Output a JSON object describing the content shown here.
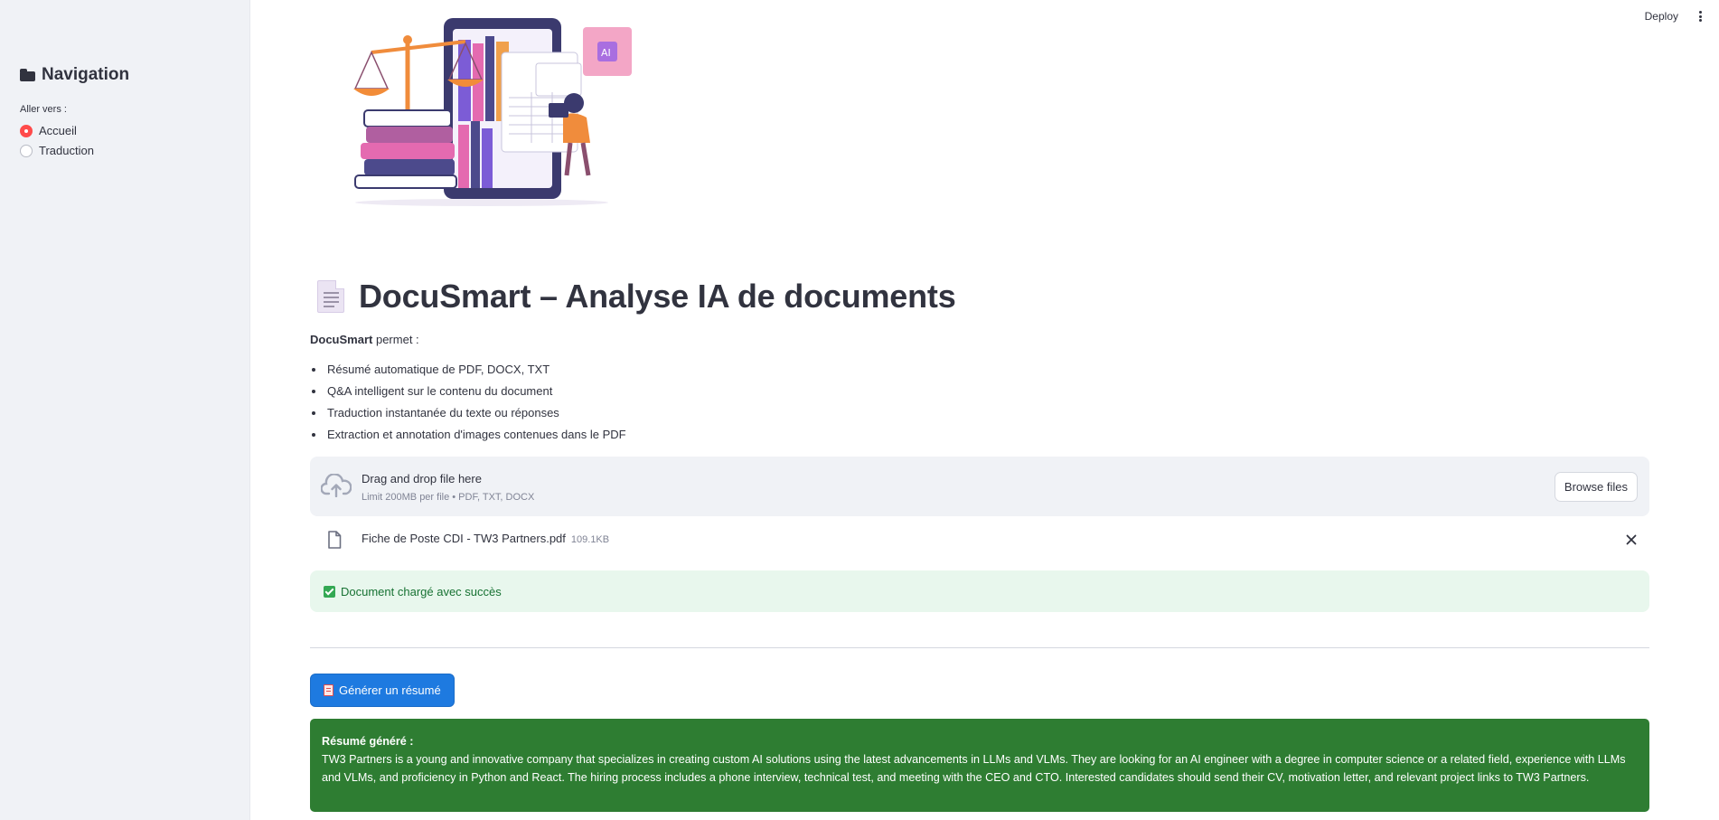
{
  "header": {
    "deploy_label": "Deploy"
  },
  "sidebar": {
    "title": "Navigation",
    "radio_label": "Aller vers :",
    "options": [
      {
        "label": "Accueil",
        "selected": true
      },
      {
        "label": "Traduction",
        "selected": false
      }
    ]
  },
  "main": {
    "title": "DocuSmart – Analyse IA de documents",
    "intro_bold": "DocuSmart",
    "intro_rest": " permet :",
    "features": [
      "Résumé automatique de PDF, DOCX, TXT",
      "Q&A intelligent sur le contenu du document",
      "Traduction instantanée du texte ou réponses",
      "Extraction et annotation d'images contenues dans le PDF"
    ],
    "uploader": {
      "main_text": "Drag and drop file here",
      "sub_text": "Limit 200MB per file • PDF, TXT, DOCX",
      "browse_label": "Browse files"
    },
    "file": {
      "name": "Fiche de Poste CDI - TW3 Partners.pdf",
      "size": "109.1KB"
    },
    "success_text": "Document chargé avec succès",
    "generate_button": "Générer un résumé",
    "summary": {
      "heading": "Résumé généré :",
      "text": "TW3 Partners is a young and innovative company that specializes in creating custom AI solutions using the latest advancements in LLMs and VLMs. They are looking for an AI engineer with a degree in computer science or a related field, experience with LLMs and VLMs, and proficiency in Python and React. The hiring process includes a phone interview, technical test, and meeting with the CEO and CTO. Interested candidates should send their CV, motivation letter, and relevant project links to TW3 Partners."
    }
  },
  "colors": {
    "sidebar_bg": "#f0f2f6",
    "radio_selected": "#ff4b4b",
    "primary_button": "#1e7ae0",
    "success_bg": "#e8f7ed",
    "success_text": "#177233",
    "summary_bg": "#2e7d32"
  },
  "icons": {
    "sidebar_title": "folder-icon",
    "page_title": "document-icon",
    "uploader": "cloud-upload-icon",
    "file": "file-icon",
    "remove_file": "close-icon",
    "success": "check-box-icon",
    "generate": "memo-icon",
    "menu": "kebab-menu-icon",
    "hero": "legal-ai-illustration"
  }
}
